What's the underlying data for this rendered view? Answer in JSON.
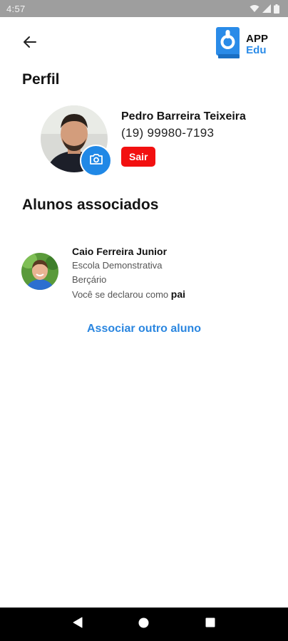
{
  "status_bar": {
    "time": "4:57"
  },
  "header": {
    "logo_line1": "APP",
    "logo_line2": "Edu"
  },
  "profile": {
    "section_title": "Perfil",
    "name": "Pedro Barreira Teixeira",
    "phone": "(19) 99980-7193",
    "logout_label": "Sair"
  },
  "students": {
    "section_title": "Alunos associados",
    "items": [
      {
        "name": "Caio Ferreira Junior",
        "school": "Escola Demonstrativa",
        "class": "Berçário",
        "relation_prefix": "Você se declarou como",
        "relation": "pai"
      }
    ],
    "associate_label": "Associar outro aluno"
  },
  "colors": {
    "accent": "#2088e6",
    "logout": "#f21010",
    "link": "#2a86e0",
    "status_bar": "#9e9e9e",
    "nav_bar": "#000000"
  },
  "icons": {
    "back": "arrow-left-icon",
    "camera": "camera-icon",
    "wifi": "wifi-icon",
    "signal": "signal-icon",
    "battery": "battery-icon",
    "nav_back": "nav-back-icon",
    "nav_home": "nav-home-icon",
    "nav_recents": "nav-recents-icon"
  }
}
